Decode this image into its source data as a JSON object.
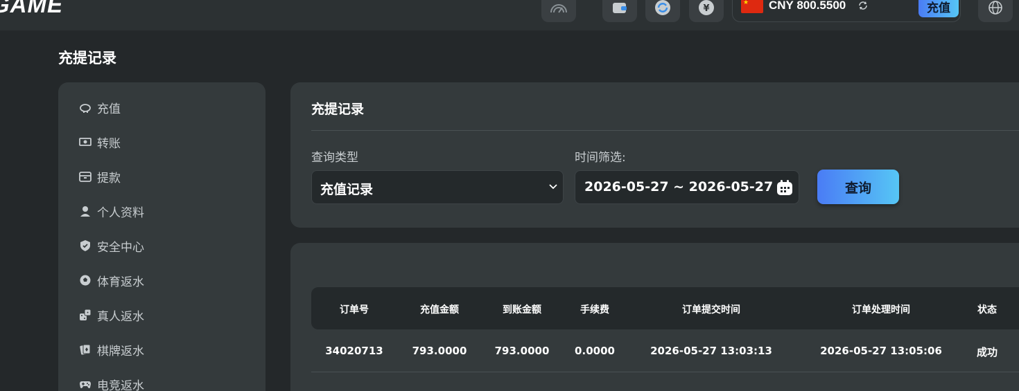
{
  "header": {
    "logo": "GAME",
    "balance": {
      "currency": "CNY",
      "amount": "800.5500",
      "deposit_label": "充值"
    },
    "icons": [
      "speedometer-icon",
      "wallet-icon",
      "refresh-circle-icon",
      "yuan-icon",
      "globe-icon"
    ]
  },
  "page": {
    "title": "充提记录"
  },
  "sidebar": {
    "items": [
      {
        "label": "充值",
        "icon": "piggy-bank-icon"
      },
      {
        "label": "转账",
        "icon": "money-icon"
      },
      {
        "label": "提款",
        "icon": "cash-drawer-icon"
      },
      {
        "label": "个人资料",
        "icon": "user-icon"
      },
      {
        "label": "安全中心",
        "icon": "shield-icon"
      },
      {
        "label": "体育返水",
        "icon": "soccer-ball-icon"
      },
      {
        "label": "真人返水",
        "icon": "dice-icon"
      },
      {
        "label": "棋牌返水",
        "icon": "cards-icon"
      },
      {
        "label": "电竞返水",
        "icon": "gamepad-icon"
      }
    ]
  },
  "filter": {
    "title": "充提记录",
    "query_type_label": "查询类型",
    "query_type_value": "充值记录",
    "time_filter_label": "时间筛选:",
    "date_range": "2026-05-27 ~ 2026-05-27",
    "query_button": "查询"
  },
  "table": {
    "columns": [
      "订单号",
      "充值金额",
      "到账金额",
      "手续费",
      "订单提交时间",
      "订单处理时间",
      "状态"
    ],
    "rows": [
      [
        "34020713",
        "793.0000",
        "793.0000",
        "0.0000",
        "2026-05-27 13:03:13",
        "2026-05-27 13:05:06",
        "成功"
      ]
    ]
  },
  "colors": {
    "background": "#24282a",
    "card": "#343a3c",
    "accent_start": "#4a7cf5",
    "accent_end": "#56c6f5"
  }
}
